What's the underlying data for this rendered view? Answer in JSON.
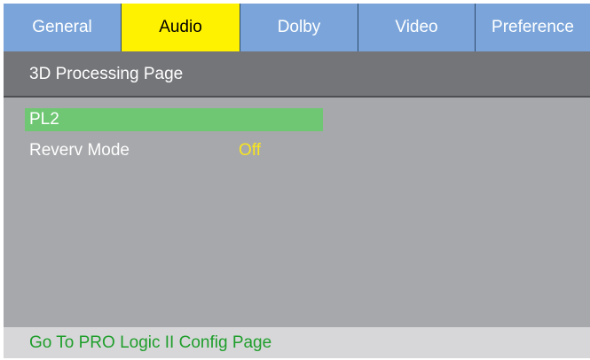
{
  "tabs": [
    {
      "label": "General",
      "active": false
    },
    {
      "label": "Audio",
      "active": true
    },
    {
      "label": "Dolby",
      "active": false
    },
    {
      "label": "Video",
      "active": false
    },
    {
      "label": "Preference",
      "active": false
    }
  ],
  "page": {
    "title": "3D Processing Page"
  },
  "menu": {
    "items": [
      {
        "label": "PL2",
        "value": "",
        "selected": true
      },
      {
        "label": "Reverv Mode",
        "value": "Off",
        "selected": false
      }
    ]
  },
  "status": {
    "text": "Go To PRO Logic II Config Page"
  },
  "colors": {
    "tab_background": "#7ba5da",
    "tab_active": "#fff200",
    "panel_background": "#a7a8ab",
    "header_background": "#747579",
    "selection": "#6fc774",
    "value_text": "#f7e51f",
    "status_text": "#1f9e2b"
  }
}
